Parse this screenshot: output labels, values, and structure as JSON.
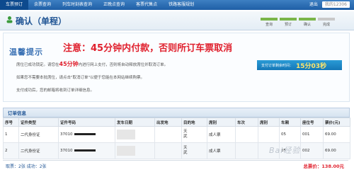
{
  "nav": {
    "tabs": [
      "车票预订",
      "余票查询",
      "列车时刻表查询",
      "正晚点查询",
      "客票代售点",
      "铁路客服规划"
    ],
    "logout": "退出",
    "user": "我的12306"
  },
  "page": {
    "title": "确认（单程）",
    "steps": [
      "查询",
      "预订",
      "确认",
      "完成"
    ]
  },
  "notice": {
    "title": "温馨提示",
    "warning": "注意：45分钟内付款，否则所订车票取消",
    "line1_a": "席位已成功锁定。请您在",
    "line1_red": "45分钟",
    "line1_b": "内进行网上支付，否则将自动释放席位并取消订单。",
    "line2": "如果您不需要本批席位，请点击\"取消订单\"以便于您能在本网站继续购票。",
    "line3": "支付成功后，您的邮箱将收到订单详细信息。",
    "timer_label": "支付订单剩余时间：",
    "timer_value": "15分03秒"
  },
  "order": {
    "title": "订单信息",
    "columns": [
      "序号",
      "证件类型",
      "证件号码",
      "发车日期",
      "出发地",
      "目的地",
      "席别",
      "车次",
      "席别",
      "车厢",
      "座位号",
      "票价(元)"
    ],
    "rows": [
      {
        "idx": "1",
        "id_type": "二代身份证",
        "id_prefix": "37010",
        "from": "",
        "to_1": "天",
        "to_2": "武",
        "seat_type": "成人票",
        "train": "",
        "cls": "",
        "car": "05",
        "seat": "001",
        "price": "69.00"
      },
      {
        "idx": "2",
        "id_type": "二代身份证",
        "id_prefix": "37010",
        "from": "",
        "to_1": "天",
        "to_2": "武",
        "seat_type": "成人票",
        "train": "",
        "cls": "",
        "car": "05",
        "seat": "002",
        "price": "69.00"
      }
    ],
    "summary_left": "取票：2张    成功：2张",
    "total": "总票价：138.00元"
  },
  "watermark": "Bai经验"
}
